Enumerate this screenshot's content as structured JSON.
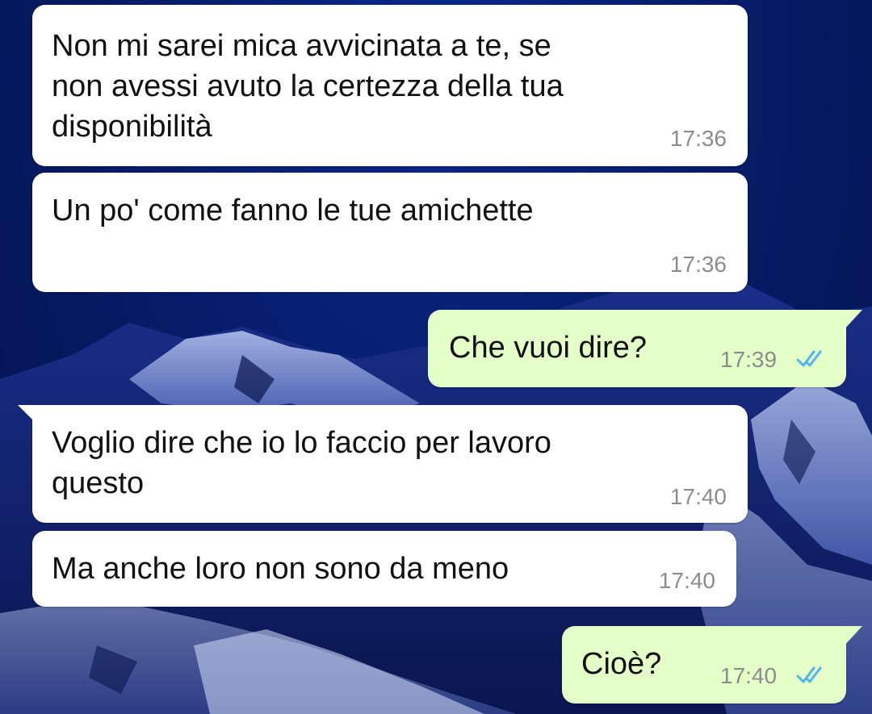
{
  "conversation": {
    "messages": [
      {
        "direction": "incoming",
        "text": "Non mi sarei mica avvicinata a te, se\nnon avessi avuto la certezza della tua\ndisponibilità",
        "time": "17:36"
      },
      {
        "direction": "incoming",
        "text": "Un po' come fanno le tue amichette",
        "time": "17:36"
      },
      {
        "direction": "outgoing",
        "text": "Che vuoi dire?",
        "time": "17:39",
        "status": "read",
        "status_icon": "double-check-icon"
      },
      {
        "direction": "incoming",
        "text": "Voglio dire che io lo faccio per lavoro\nquesto",
        "time": "17:40"
      },
      {
        "direction": "incoming",
        "text": "Ma anche loro non sono da meno",
        "time": "17:40"
      },
      {
        "direction": "outgoing",
        "text": "Cioè?",
        "time": "17:40",
        "status": "read",
        "status_icon": "double-check-icon"
      }
    ]
  },
  "colors": {
    "incoming_bubble": "#ffffff",
    "outgoing_bubble": "#e5ffc8",
    "read_ticks": "#4fb6ec",
    "timestamp": "#8c8c8c",
    "wallpaper": "#071e6e"
  }
}
